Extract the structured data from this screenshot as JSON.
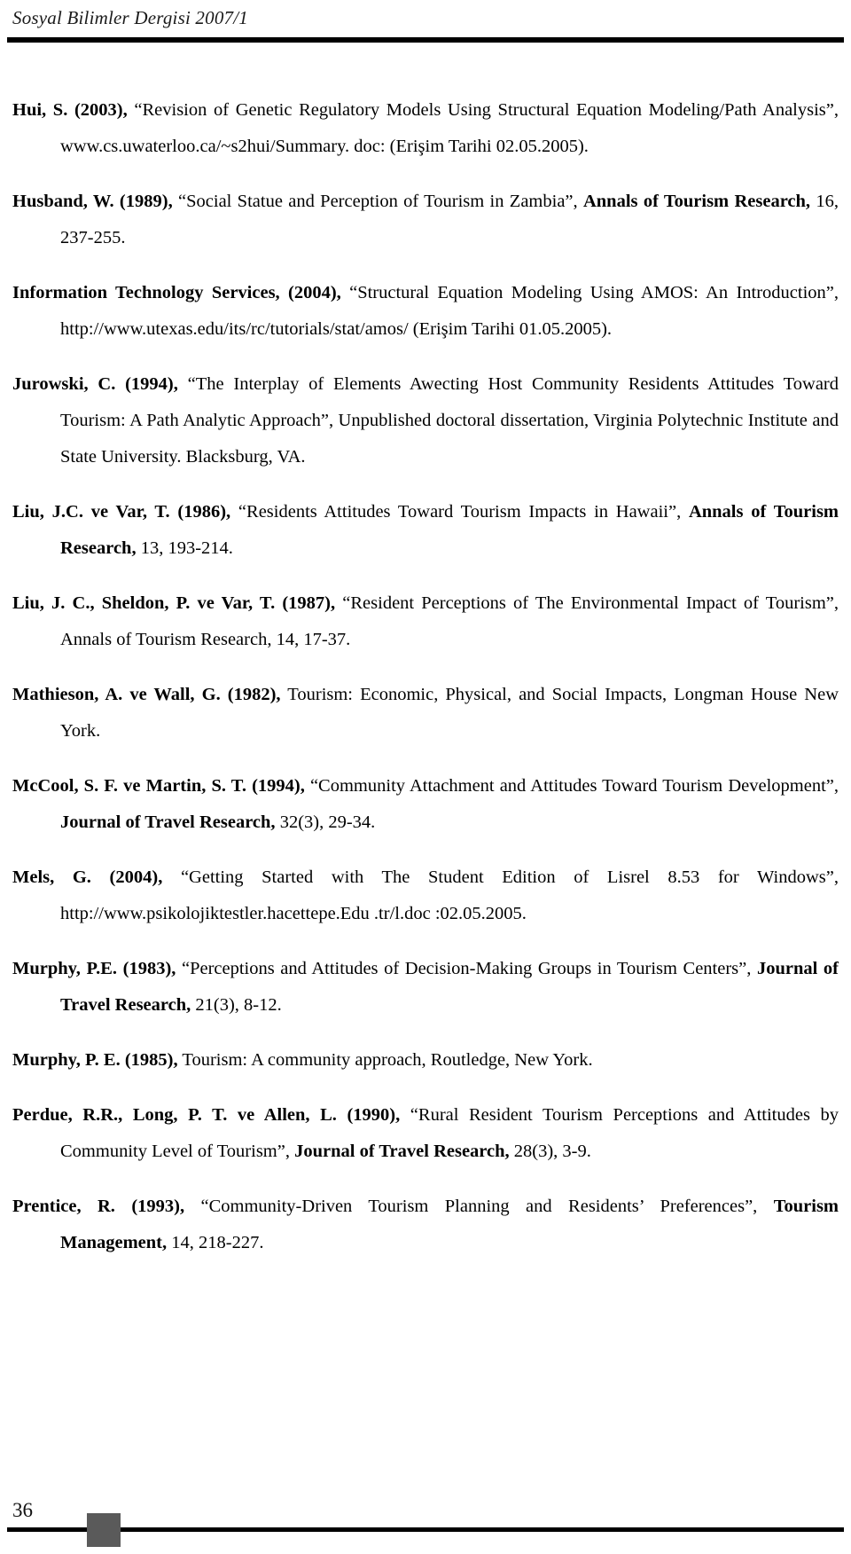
{
  "header": {
    "running_head": "Sosyal Bilimler Dergisi 2007/1"
  },
  "footer": {
    "page_number": "36",
    "marker_color": "#5a5a5a",
    "rule_color": "#000000"
  },
  "references": [
    {
      "id": "hui-2003",
      "author": "Hui, S. (2003),",
      "body": " “Revision of Genetic Regulatory Models Using Structural Equation Modeling/Path Analysis”, www.cs.uwaterloo.ca/~s2hui/Summary. doc: (Erişim Tarihi 02.05.2005)."
    },
    {
      "id": "husband-1989",
      "author": "Husband, W. (1989),",
      "body": " “Social Statue and Perception of Tourism in Zambia”, ",
      "source": "Annals of Tourism Research,",
      "tail": " 16, 237-255."
    },
    {
      "id": "information-technology-services-2004",
      "author": "Information Technology Services, (2004),",
      "body": " “Structural Equation Modeling Using AMOS: An Introduction”, http://www.utexas.edu/its/rc/tutorials/stat/amos/ (Erişim Tarihi 01.05.2005)."
    },
    {
      "id": "jurowski-1994",
      "author": "Jurowski, C. (1994),",
      "body": " “The Interplay of Elements Awecting Host Community Residents Attitudes Toward Tourism: A Path Analytic Approach”, Unpublished doctoral dissertation, Virginia Polytechnic Institute and State University. Blacksburg, VA."
    },
    {
      "id": "liu-var-1986",
      "author": "Liu, J.C. ve Var, T. (1986),",
      "body": " “Residents Attitudes Toward Tourism Impacts in Hawaii”, ",
      "source": "Annals of Tourism Research,",
      "tail": " 13, 193-214."
    },
    {
      "id": "liu-sheldon-var-1987",
      "author": "Liu, J. C., Sheldon, P. ve Var, T. (1987),",
      "body": " “Resident Perceptions of The Environmental Impact of Tourism”, Annals of Tourism Research, 14, 17-37."
    },
    {
      "id": "mathieson-wall-1982",
      "author": "Mathieson, A. ve Wall, G. (1982),",
      "body": " Tourism: Economic, Physical, and Social Impacts, Longman House New York."
    },
    {
      "id": "mccool-martin-1994",
      "author": "McCool, S. F. ve Martin, S. T. (1994),",
      "body": " “Community Attachment and Attitudes Toward Tourism Development”, ",
      "source": "Journal of Travel Research,",
      "tail": " 32(3), 29-34."
    },
    {
      "id": "mels-2004",
      "author": "Mels, G. (2004),",
      "body": " “Getting Started with The Student Edition of Lisrel 8.53 for Windows”, http://www.psikolojiktestler.hacettepe.Edu .tr/l.doc :02.05.2005."
    },
    {
      "id": "murphy-1983",
      "author": "Murphy, P.E. (1983),",
      "body": " “Perceptions and Attitudes of Decision-Making Groups in Tourism Centers”, ",
      "source": "Journal of Travel Research,",
      "tail": " 21(3), 8-12."
    },
    {
      "id": "murphy-1985",
      "author": "Murphy, P. E. (1985),",
      "body": " Tourism: A community approach, Routledge, New York."
    },
    {
      "id": "perdue-long-allen-1990",
      "author": "Perdue, R.R., Long, P. T. ve Allen, L. (1990),",
      "body": " “Rural Resident Tourism Perceptions and Attitudes by Community Level of Tourism”, ",
      "source": "Journal of Travel Research,",
      "tail": " 28(3), 3-9."
    },
    {
      "id": "prentice-1993",
      "author": "Prentice, R. (1993),",
      "body": " “Community-Driven Tourism Planning and Residents’ Preferences”, ",
      "source": "Tourism Management,",
      "tail": " 14, 218-227."
    }
  ]
}
